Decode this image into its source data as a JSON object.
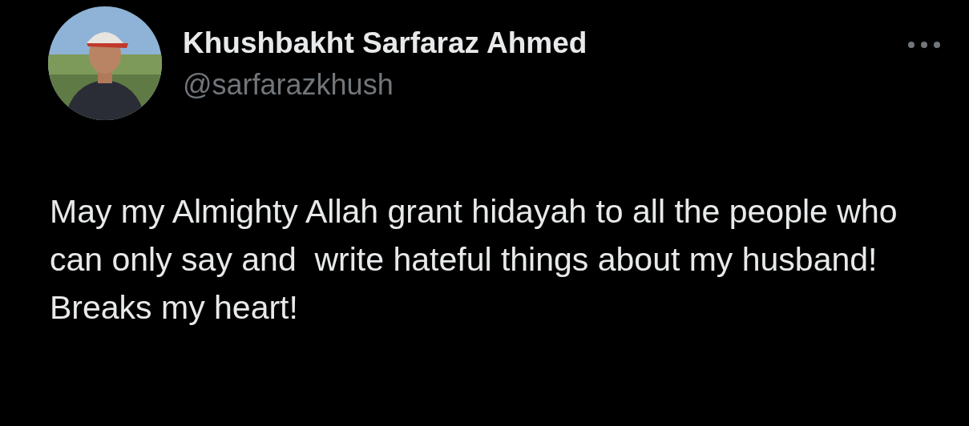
{
  "tweet": {
    "author_name": "Khushbakht Sarfaraz Ahmed",
    "handle": "@sarfarazkhush",
    "text": "May my Almighty Allah grant hidayah to all the people who can only say and  write hateful things about my husband!\nBreaks my heart!"
  }
}
